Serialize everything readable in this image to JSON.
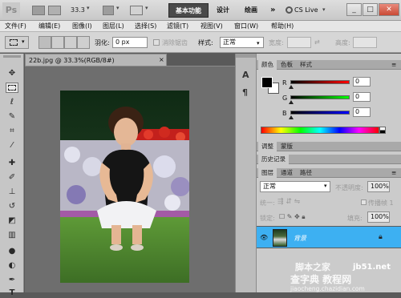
{
  "titlebar": {
    "logo": "Ps",
    "zoom": "33.3",
    "workspaces": [
      "基本功能",
      "设计",
      "绘画"
    ],
    "more": "»",
    "cslive": "CS Live",
    "win_buttons": [
      "_",
      "□",
      "✕"
    ]
  },
  "menu": [
    "文件(F)",
    "编辑(E)",
    "图像(I)",
    "图层(L)",
    "选择(S)",
    "滤镜(T)",
    "视图(V)",
    "窗口(W)",
    "帮助(H)"
  ],
  "options": {
    "feather_label": "羽化:",
    "feather_value": "0 px",
    "antialias_label": "消除锯齿",
    "style_label": "样式:",
    "style_value": "正常",
    "width_label": "宽度:",
    "height_label": "高度:"
  },
  "document": {
    "tab_title": "22b.jpg @ 33.3%(RGB/8#)",
    "close": "×"
  },
  "tools": [
    "move-icon",
    "marquee-icon",
    "lasso-icon",
    "quick-select-icon",
    "crop-icon",
    "eyedropper-icon",
    "healing-icon",
    "brush-icon",
    "stamp-icon",
    "history-brush-icon",
    "eraser-icon",
    "gradient-icon",
    "blur-icon",
    "dodge-icon",
    "pen-icon",
    "type-icon"
  ],
  "panels": {
    "color_tabs": [
      "颜色",
      "色板",
      "样式"
    ],
    "channels": [
      {
        "label": "R",
        "value": "0"
      },
      {
        "label": "G",
        "value": "0"
      },
      {
        "label": "B",
        "value": "0"
      }
    ],
    "adjust_tabs": [
      "调整",
      "蒙版"
    ],
    "history_tab": "历史记录",
    "layer_tabs": [
      "图层",
      "通道",
      "路径"
    ],
    "blend_mode": "正常",
    "opacity_label": "不透明度:",
    "opacity_value": "100%",
    "unify_label": "统一:",
    "propagate_label": "传播帧 1",
    "lock_label": "锁定:",
    "fill_label": "填充:",
    "fill_value": "100%",
    "layer_name": "背景"
  },
  "watermark": {
    "line1": "脚本之家",
    "line2": "jb51.net",
    "line3": "查字典 教程网",
    "line4": "jiaocheng.chazidian.com"
  },
  "colors": {
    "accent": "#3db0f2",
    "workspace_active": "#4a4a4a",
    "canvas_bg": "#6e6e6e"
  }
}
